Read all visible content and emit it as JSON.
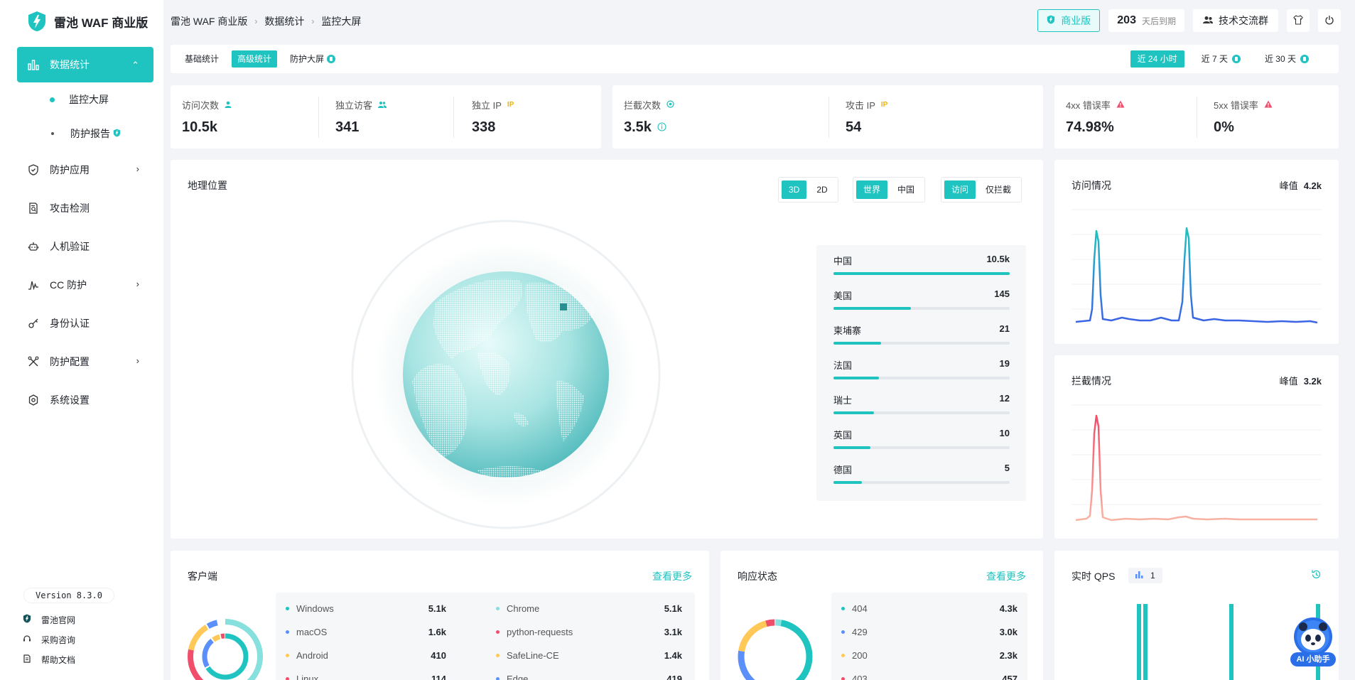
{
  "brand": {
    "name": "雷池 WAF 商业版"
  },
  "sidebar": {
    "items": [
      {
        "label": "数据统计",
        "icon": "bar-chart-icon",
        "active": true,
        "expandable": true
      },
      {
        "label": "防护应用",
        "icon": "shield-icon",
        "expandable": true
      },
      {
        "label": "攻击检测",
        "icon": "document-search-icon"
      },
      {
        "label": "人机验证",
        "icon": "robot-icon"
      },
      {
        "label": "CC 防护",
        "icon": "pulse-icon",
        "expandable": true
      },
      {
        "label": "身份认证",
        "icon": "key-icon"
      },
      {
        "label": "防护配置",
        "icon": "tools-icon",
        "expandable": true
      },
      {
        "label": "系统设置",
        "icon": "gear-icon"
      }
    ],
    "sub_items": [
      {
        "label": "监控大屏",
        "active": true
      },
      {
        "label": "防护报告"
      }
    ],
    "version": "Version 8.3.0",
    "footer_links": [
      "雷池官网",
      "采购咨询",
      "帮助文档"
    ]
  },
  "breadcrumb": [
    "雷池 WAF 商业版",
    "数据统计",
    "监控大屏"
  ],
  "header": {
    "pro_label": "商业版",
    "days": "203",
    "days_suffix": "天后到期",
    "group_label": "技术交流群"
  },
  "tabs": [
    "基础统计",
    "高级统计",
    "防护大屏"
  ],
  "ranges": [
    "近 24 小时",
    "近 7 天",
    "近 30 天"
  ],
  "stats": {
    "visits": {
      "label": "访问次数",
      "value": "10.5k"
    },
    "unique_visitors": {
      "label": "独立访客",
      "value": "341"
    },
    "unique_ip": {
      "label": "独立 IP",
      "value": "338",
      "tag": "IP"
    },
    "blocks": {
      "label": "拦截次数",
      "value": "3.5k"
    },
    "attack_ip": {
      "label": "攻击 IP",
      "value": "54",
      "tag": "IP"
    },
    "err4xx": {
      "label": "4xx 错误率",
      "value": "74.98%"
    },
    "err5xx": {
      "label": "5xx 错误率",
      "value": "0%"
    }
  },
  "geo": {
    "title": "地理位置",
    "mode": [
      "3D",
      "2D"
    ],
    "scope": [
      "世界",
      "中国"
    ],
    "filter": [
      "访问",
      "仅拦截"
    ],
    "countries": [
      {
        "name": "中国",
        "value": "10.5k",
        "ratio": 1.0
      },
      {
        "name": "美国",
        "value": "145",
        "ratio": 0.44
      },
      {
        "name": "柬埔寨",
        "value": "21",
        "ratio": 0.27
      },
      {
        "name": "法国",
        "value": "19",
        "ratio": 0.26
      },
      {
        "name": "瑞士",
        "value": "12",
        "ratio": 0.23
      },
      {
        "name": "英国",
        "value": "10",
        "ratio": 0.21
      },
      {
        "name": "德国",
        "value": "5",
        "ratio": 0.16
      }
    ]
  },
  "access_chart": {
    "title": "访问情况",
    "peak_label": "峰值",
    "peak_value": "4.2k",
    "color_start": "#1fc3c0",
    "color_end": "#3b63e6"
  },
  "block_chart": {
    "title": "拦截情况",
    "peak_label": "峰值",
    "peak_value": "3.2k",
    "color_start": "#f04e6b",
    "color_end": "#f8b3a3"
  },
  "client": {
    "title": "客户端",
    "more": "查看更多",
    "left": [
      {
        "name": "Windows",
        "value": "5.1k",
        "color": "#1fc3c0"
      },
      {
        "name": "macOS",
        "value": "1.6k",
        "color": "#5b8ff9"
      },
      {
        "name": "Android",
        "value": "410",
        "color": "#ffc857"
      },
      {
        "name": "Linux",
        "value": "114",
        "color": "#f04e6b"
      }
    ],
    "right": [
      {
        "name": "Chrome",
        "value": "5.1k",
        "color": "#86e0dd"
      },
      {
        "name": "python-requests",
        "value": "3.1k",
        "color": "#f04e6b"
      },
      {
        "name": "SafeLine-CE",
        "value": "1.4k",
        "color": "#ffc857"
      },
      {
        "name": "Edge",
        "value": "419",
        "color": "#5b8ff9"
      }
    ]
  },
  "response": {
    "title": "响应状态",
    "more": "查看更多",
    "items": [
      {
        "name": "404",
        "value": "4.3k",
        "color": "#1fc3c0"
      },
      {
        "name": "429",
        "value": "3.0k",
        "color": "#5b8ff9"
      },
      {
        "name": "200",
        "value": "2.3k",
        "color": "#ffc857"
      },
      {
        "name": "403",
        "value": "457",
        "color": "#f04e6b"
      }
    ]
  },
  "qps": {
    "title": "实时 QPS",
    "badge_value": "1"
  },
  "ai": {
    "label": "AI 小助手"
  }
}
